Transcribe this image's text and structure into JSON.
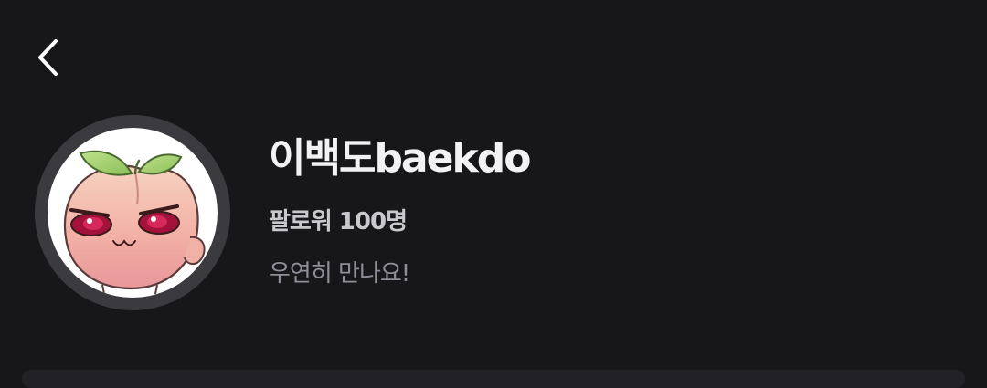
{
  "header": {
    "back_icon": "chevron-left-icon"
  },
  "profile": {
    "avatar_icon": "peach-character-avatar",
    "name": "이백도baekdo",
    "followers": "팔로워 100명",
    "bio": "우연히 만나요!"
  },
  "colors": {
    "background": "#17171a",
    "name_text": "#f2f2f5",
    "followers_text": "#c8c8cd",
    "bio_text": "#8e8e96",
    "avatar_ring": "#3a3a3f"
  }
}
